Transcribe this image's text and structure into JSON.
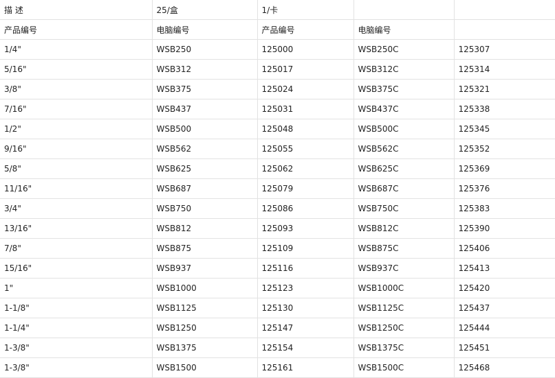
{
  "header": {
    "row1": [
      "描 述",
      "25/盒",
      "1/卡",
      "",
      ""
    ],
    "row2": [
      "产品编号",
      "电脑编号",
      "产品编号",
      "电脑编号",
      ""
    ]
  },
  "rows": [
    [
      "1/4\"",
      "WSB250",
      "125000",
      "WSB250C",
      "125307"
    ],
    [
      "5/16\"",
      "WSB312",
      "125017",
      "WSB312C",
      "125314"
    ],
    [
      "3/8\"",
      "WSB375",
      "125024",
      "WSB375C",
      "125321"
    ],
    [
      "7/16\"",
      "WSB437",
      "125031",
      "WSB437C",
      "125338"
    ],
    [
      "1/2\"",
      "WSB500",
      "125048",
      "WSB500C",
      "125345"
    ],
    [
      "9/16\"",
      "WSB562",
      "125055",
      "WSB562C",
      "125352"
    ],
    [
      "5/8\"",
      "WSB625",
      "125062",
      "WSB625C",
      "125369"
    ],
    [
      "11/16\"",
      "WSB687",
      "125079",
      "WSB687C",
      "125376"
    ],
    [
      "3/4\"",
      "WSB750",
      "125086",
      "WSB750C",
      "125383"
    ],
    [
      "13/16\"",
      "WSB812",
      "125093",
      "WSB812C",
      "125390"
    ],
    [
      "7/8\"",
      "WSB875",
      "125109",
      "WSB875C",
      "125406"
    ],
    [
      "15/16\"",
      "WSB937",
      "125116",
      "WSB937C",
      "125413"
    ],
    [
      "1\"",
      "WSB1000",
      "125123",
      "WSB1000C",
      "125420"
    ],
    [
      "1-1/8\"",
      "WSB1125",
      "125130",
      "WSB1125C",
      "125437"
    ],
    [
      "1-1/4\"",
      "WSB1250",
      "125147",
      "WSB1250C",
      "125444"
    ],
    [
      "1-3/8\"",
      "WSB1375",
      "125154",
      "WSB1375C",
      "125451"
    ],
    [
      "1-3/8\"",
      "WSB1500",
      "125161",
      "WSB1500C",
      "125468"
    ]
  ]
}
